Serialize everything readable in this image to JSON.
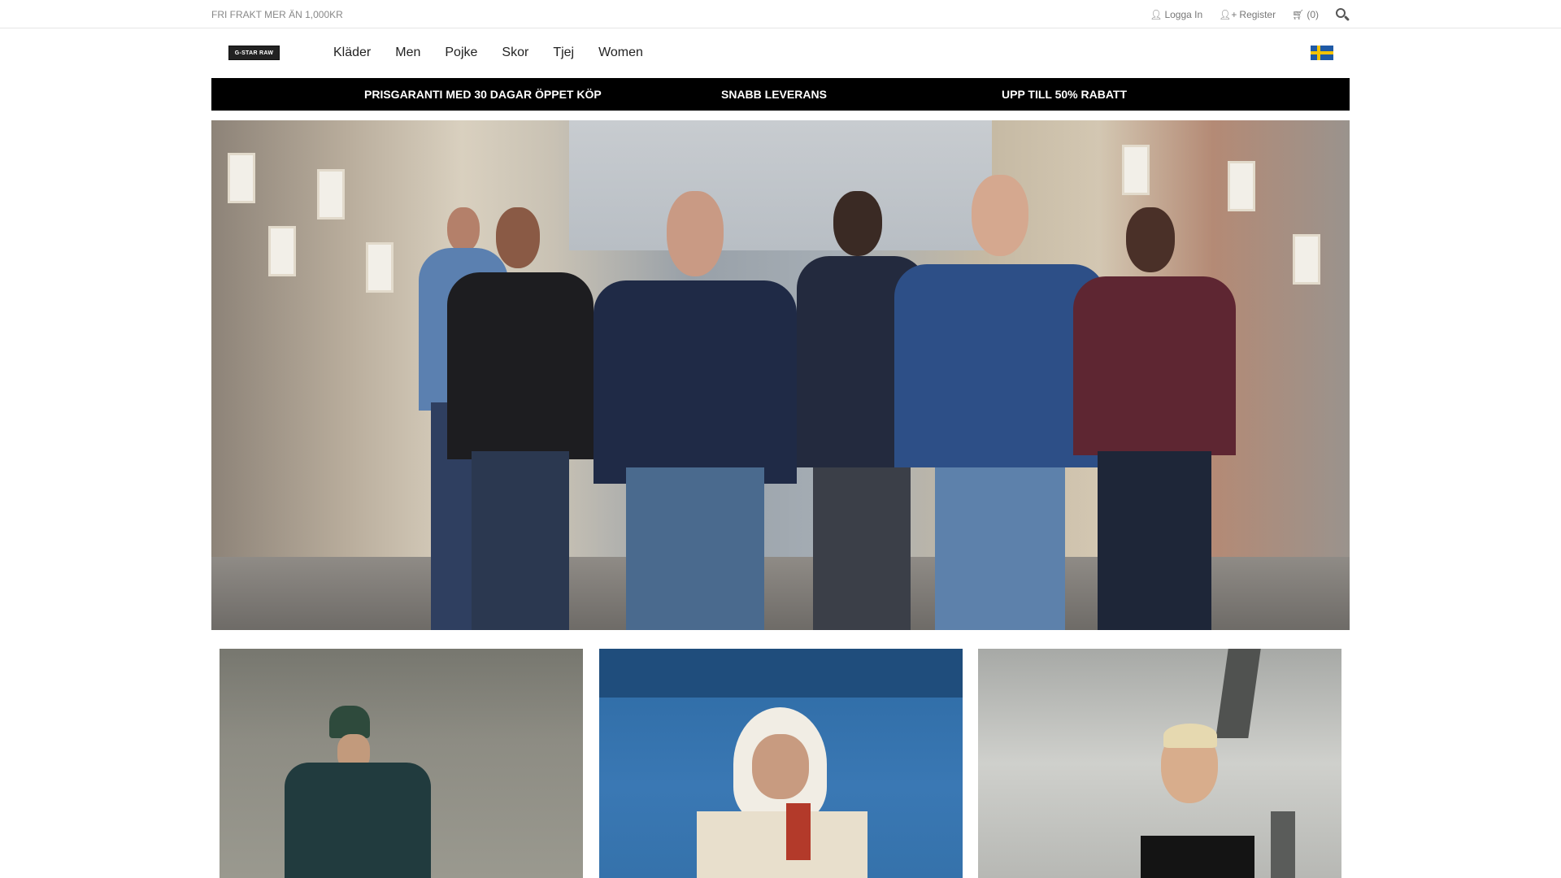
{
  "topbar": {
    "promo": "FRI FRAKT MER ÄN 1,000Kr",
    "login_label": "Logga In",
    "register_label": "Register",
    "cart_label": "(0)",
    "icons": [
      "user-icon",
      "user-plus-icon",
      "cart-icon",
      "search-icon"
    ]
  },
  "nav": {
    "logo_text": "G-STAR RAW",
    "items": [
      "Kläder",
      "Men",
      "Pojke",
      "Skor",
      "Tjej",
      "Women"
    ],
    "flag": "sweden-flag-icon"
  },
  "usp": {
    "items": [
      "PRISGARANTI MED 30 DAGAR ÖPPET KÖP",
      "SNABB LEVERANS",
      "UPP TILL 50% RABATT"
    ]
  },
  "colors": {
    "usp_background": "#000000",
    "usp_text": "#ffffff",
    "link_gray": "#777777"
  }
}
